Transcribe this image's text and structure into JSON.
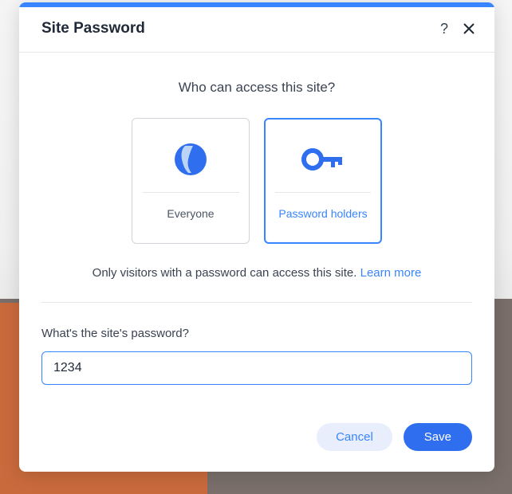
{
  "modal": {
    "title": "Site Password",
    "heading": "Who can access this site?",
    "options": {
      "everyone": {
        "label": "Everyone"
      },
      "password_holders": {
        "label": "Password holders"
      }
    },
    "description": "Only visitors with a password can access this site. ",
    "learn_more": "Learn more",
    "field_label": "What's the site's password?",
    "password_value": "1234",
    "buttons": {
      "cancel": "Cancel",
      "save": "Save"
    },
    "help_char": "?"
  }
}
